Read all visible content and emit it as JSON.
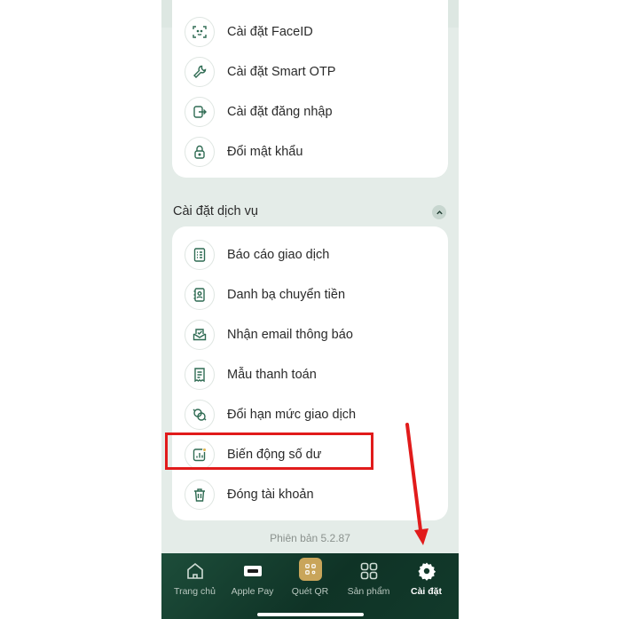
{
  "security_items": [
    {
      "label": "Cài đặt FaceID",
      "icon": "faceid-icon"
    },
    {
      "label": "Cài đặt Smart OTP",
      "icon": "wrench-icon"
    },
    {
      "label": "Cài đặt đăng nhập",
      "icon": "login-icon"
    },
    {
      "label": "Đổi mật khẩu",
      "icon": "lock-icon"
    }
  ],
  "service_section": {
    "title": "Cài đặt dịch vụ",
    "items": [
      {
        "label": "Báo cáo giao dịch",
        "icon": "report-icon"
      },
      {
        "label": "Danh bạ chuyển tiền",
        "icon": "contact-book-icon"
      },
      {
        "label": "Nhận email thông báo",
        "icon": "email-icon"
      },
      {
        "label": "Mẫu thanh toán",
        "icon": "template-icon"
      },
      {
        "label": "Đổi hạn mức giao dịch",
        "icon": "limit-icon"
      },
      {
        "label": "Biến động số dư",
        "icon": "balance-chart-icon"
      },
      {
        "label": "Đóng tài khoản",
        "icon": "trash-icon"
      }
    ]
  },
  "version": "Phiên bản 5.2.87",
  "tabs": [
    {
      "label": "Trang chủ",
      "icon": "home-icon"
    },
    {
      "label": "Apple Pay",
      "icon": "apple-pay-icon"
    },
    {
      "label": "Quét QR",
      "icon": "qr-icon"
    },
    {
      "label": "Sản phẩm",
      "icon": "products-icon"
    },
    {
      "label": "Cài đặt",
      "icon": "gear-icon",
      "active": true
    }
  ],
  "colors": {
    "accent_green": "#1d4d3a",
    "icon_green": "#2f6b53",
    "qr_gold": "#c9a55a",
    "highlight_red": "#e11b1b"
  }
}
